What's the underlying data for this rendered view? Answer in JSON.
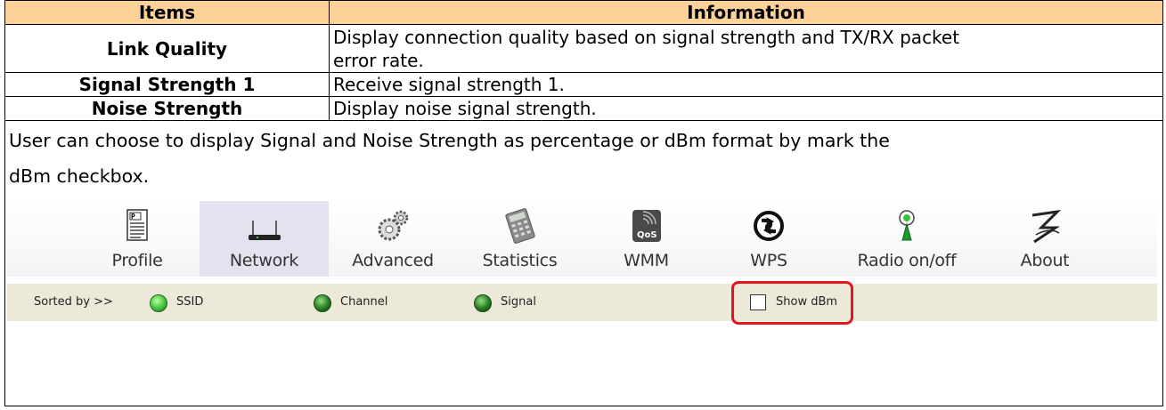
{
  "table": {
    "headers": [
      "Items",
      "Information"
    ],
    "rows": [
      {
        "item": "Link Quality",
        "info_line1": "Display connection quality based on signal strength and TX/RX packet",
        "info_line2": "error rate."
      },
      {
        "item": "Signal Strength 1",
        "info_line1": "Receive signal strength 1."
      },
      {
        "item": "Noise Strength",
        "info_line1": "Display noise signal strength."
      }
    ],
    "note_line1": "User can choose to display Signal and Noise Strength as percentage or dBm format by mark the",
    "note_line2": "dBm checkbox."
  },
  "toolbar": {
    "buttons": [
      {
        "label": "Profile",
        "icon": "profile-icon"
      },
      {
        "label": "Network",
        "icon": "network-icon",
        "active": true
      },
      {
        "label": "Advanced",
        "icon": "advanced-gears-icon"
      },
      {
        "label": "Statistics",
        "icon": "statistics-calculator-icon"
      },
      {
        "label": "WMM",
        "icon": "qos-icon"
      },
      {
        "label": "WPS",
        "icon": "wps-icon"
      },
      {
        "label": "Radio on/off",
        "icon": "radio-antenna-icon"
      },
      {
        "label": "About",
        "icon": "about-logo-icon"
      }
    ],
    "qos_text": "QoS"
  },
  "sortbar": {
    "label": "Sorted by >>",
    "ssid": "SSID",
    "channel": "Channel",
    "signal": "Signal",
    "show_dbm": "Show dBm"
  },
  "colors": {
    "header_bg": "#fcd299",
    "highlight": "#e5161b",
    "sortbar_bg": "#ece9d8"
  }
}
